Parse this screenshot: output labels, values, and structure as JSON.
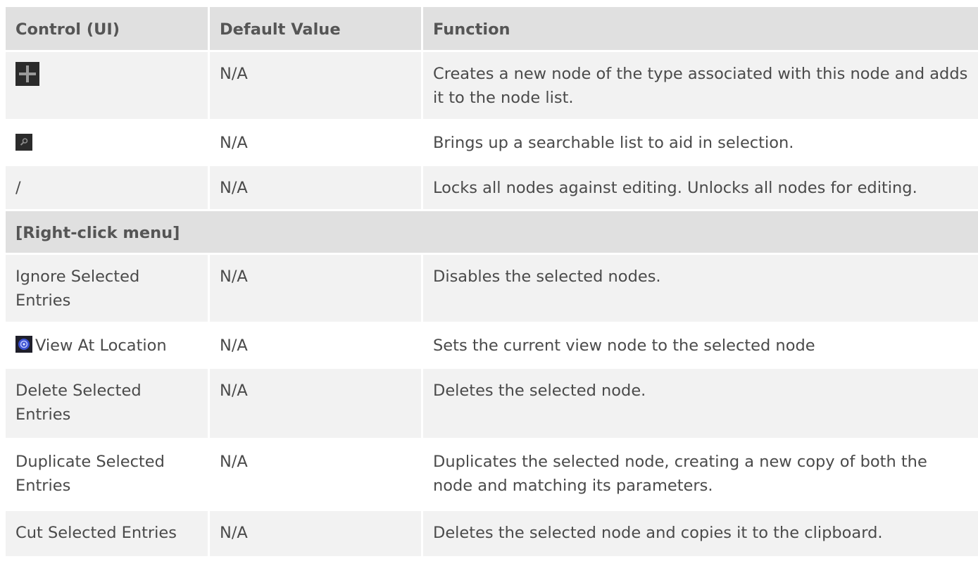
{
  "table": {
    "headers": {
      "control": "Control (UI)",
      "default": "Default Value",
      "function": "Function"
    },
    "rows": [
      {
        "control_icon": "plus-icon",
        "default": "N/A",
        "function": "Creates a new node of the type associated with this node and adds it to the node list."
      },
      {
        "control_icon": "search-icon",
        "default": "N/A",
        "function": "Brings up a searchable list to aid in selection."
      },
      {
        "control": "/",
        "default": "N/A",
        "function": "Locks all nodes against editing. Unlocks all nodes for editing."
      }
    ],
    "section_title": "[Right-click menu]",
    "menu_rows": [
      {
        "control": "Ignore Selected Entries",
        "default": "N/A",
        "function": "Disables the selected nodes."
      },
      {
        "control_icon": "view-location-icon",
        "control": "View At Location",
        "default": "N/A",
        "function": "Sets the current view node to the selected node"
      },
      {
        "control": "Delete Selected Entries",
        "default": "N/A",
        "function": "Deletes the selected node."
      },
      {
        "control": "Duplicate Selected Entries",
        "default": "N/A",
        "function": "Duplicates the selected node, creating a new copy of both the node and matching its parameters."
      },
      {
        "control": "Cut Selected Entries",
        "default": "N/A",
        "function": "Deletes the selected node and copies it to the clipboard."
      }
    ]
  },
  "colors": {
    "header_bg": "#e0e0e0",
    "odd_row_bg": "#f2f2f2",
    "even_row_bg": "#ffffff",
    "text": "#4a4a4a"
  }
}
